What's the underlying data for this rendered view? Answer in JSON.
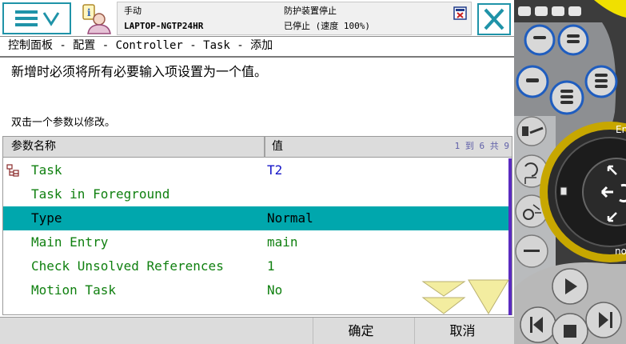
{
  "colors": {
    "accent": "#1f93a8",
    "selected_row": "#00a7ad",
    "param_text": "#108010",
    "value_text_blue": "#1414c8",
    "range_text": "#5f5fa8",
    "scroll_arrow": "#f3eda0"
  },
  "topbar": {
    "menu_icon": "hamburger-chevron-icon",
    "user_icon": "user-info-icon",
    "mode": "手动",
    "host": "LAPTOP-NGTP24HR",
    "state": "防护装置停止",
    "speed": "已停止 (速度 100%)",
    "close_icon": "close-icon"
  },
  "breadcrumb": "控制面板 - 配置 - Controller - Task - 添加",
  "instruction": "新增时必须将所有必要输入项设置为一个值。",
  "hint": "双击一个参数以修改。",
  "table": {
    "col_name": "参数名称",
    "col_value": "值",
    "range": "1 到 6 共 9",
    "rows": [
      {
        "name": "Task",
        "value": "T2"
      },
      {
        "name": "Task in Foreground",
        "value": ""
      },
      {
        "name": "Type",
        "value": "Normal"
      },
      {
        "name": "Main Entry",
        "value": "main"
      },
      {
        "name": "Check Unsolved References",
        "value": "1"
      },
      {
        "name": "Motion Task",
        "value": "No"
      }
    ],
    "selected_index": 2
  },
  "footer": {
    "ok": "确定",
    "cancel": "取消"
  },
  "device": {
    "joystick_partial_label": "En",
    "bottom_partial_label": "no"
  }
}
